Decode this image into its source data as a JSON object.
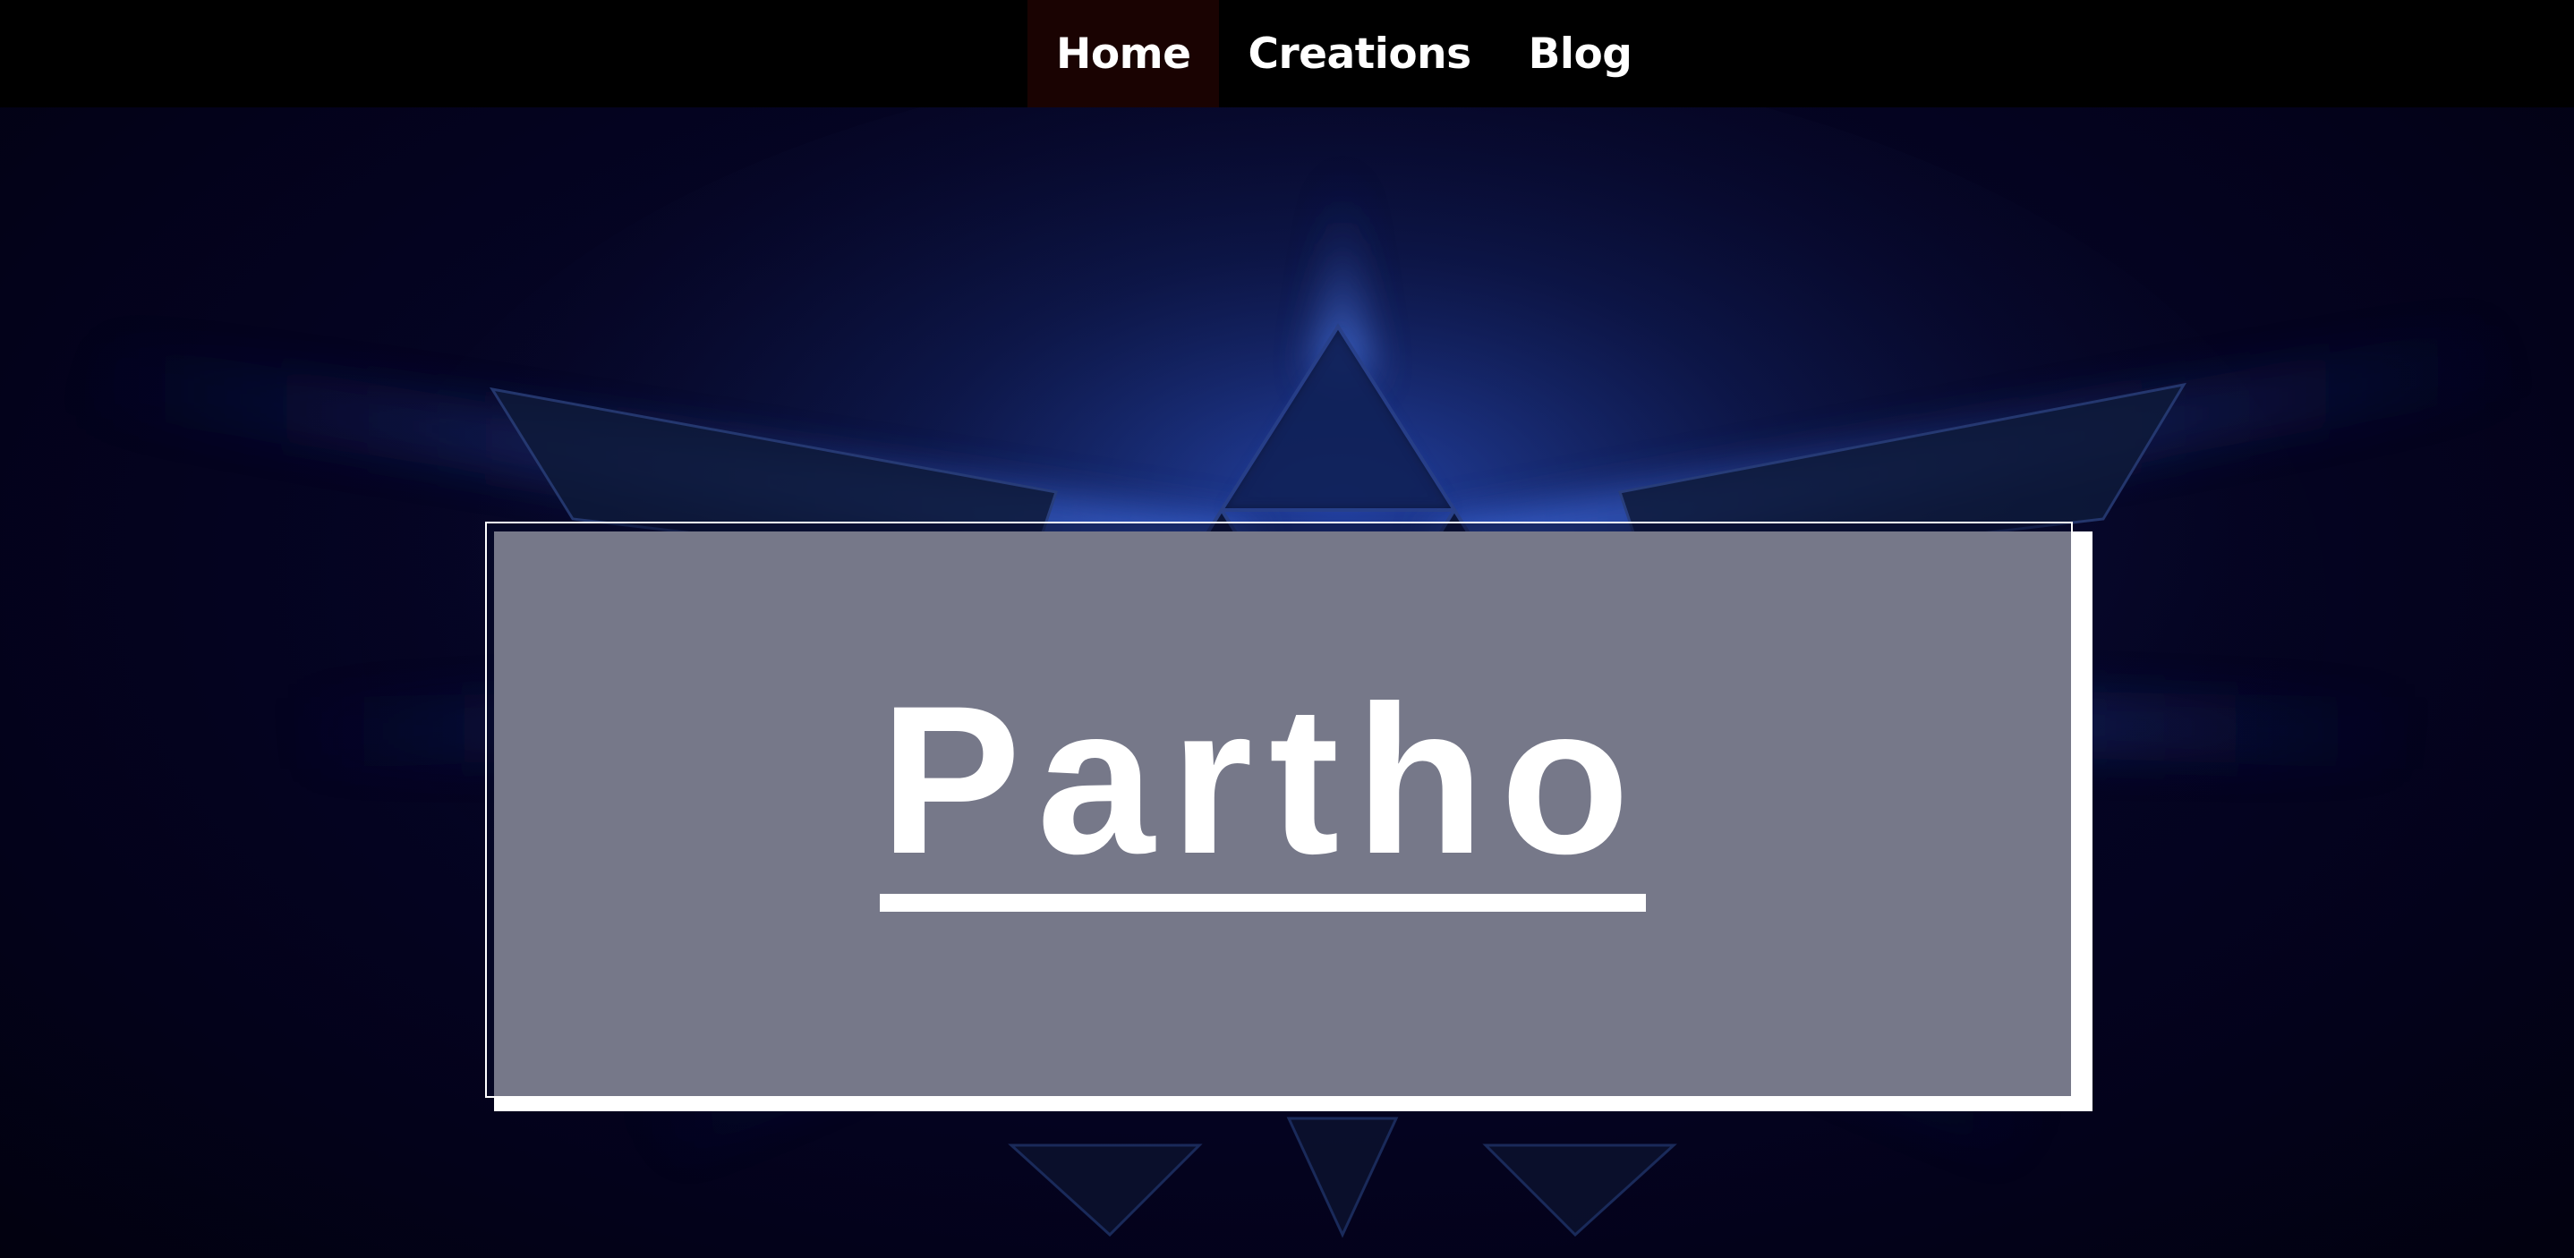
{
  "nav": {
    "items": [
      {
        "label": "Home",
        "active": true
      },
      {
        "label": "Creations",
        "active": false
      },
      {
        "label": "Blog",
        "active": false
      }
    ]
  },
  "hero": {
    "title": "Partho",
    "background_icon": "hylian-crest-triforce-icon"
  },
  "colors": {
    "nav_background": "#000000",
    "nav_active_background": "#1a0302",
    "page_background": "#03021a",
    "accent_glow": "#2f6bff",
    "text": "#ffffff"
  }
}
